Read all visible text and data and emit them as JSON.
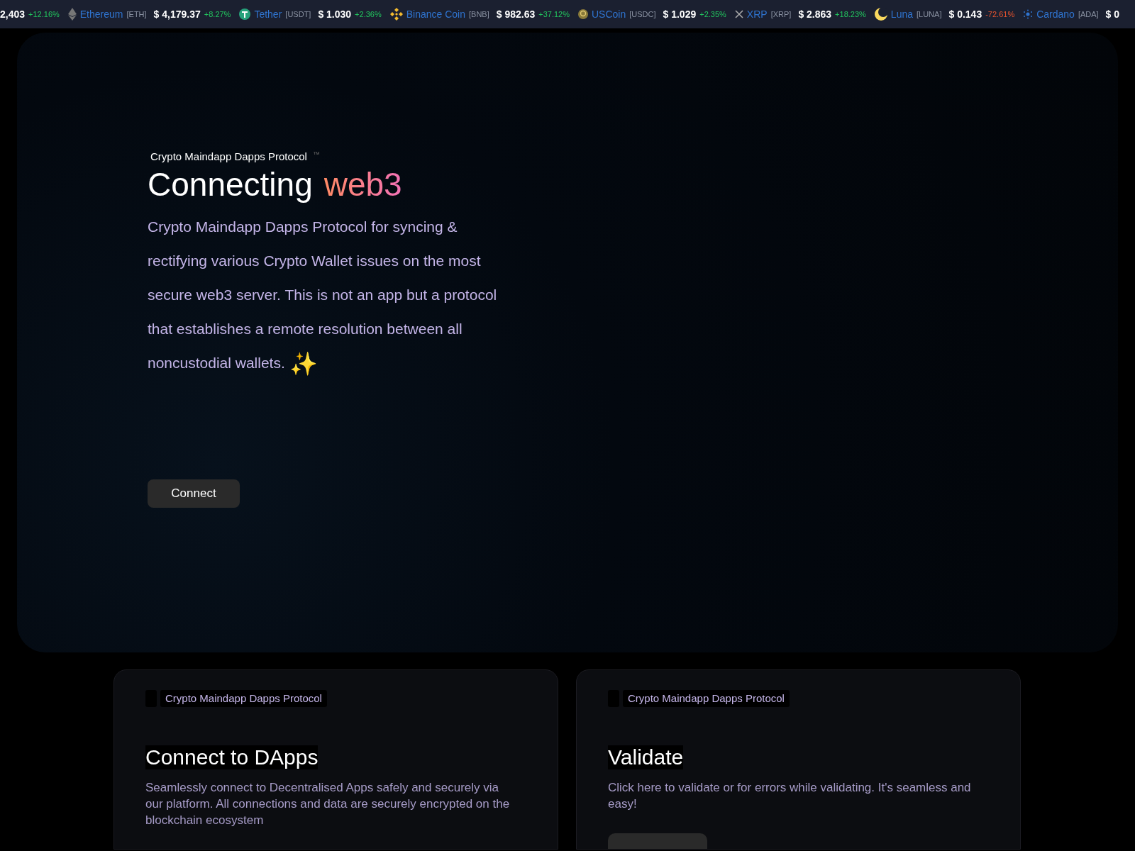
{
  "ticker": [
    {
      "price": "2,403",
      "change": "+12.16%",
      "color": "#22c55e"
    },
    {
      "name": "Ethereum",
      "symbol": "[ETH]",
      "price": "$ 4,179.37",
      "change": "+8.27%",
      "color": "#22c55e"
    },
    {
      "name": "Tether",
      "symbol": "[USDT]",
      "price": "$ 1.030",
      "change": "+2.36%",
      "color": "#22c55e"
    },
    {
      "name": "Binance Coin",
      "symbol": "[BNB]",
      "price": "$ 982.63",
      "change": "+37.12%",
      "color": "#22c55e"
    },
    {
      "name": "USCoin",
      "symbol": "[USDC]",
      "price": "$ 1.029",
      "change": "+2.35%",
      "color": "#22c55e"
    },
    {
      "name": "XRP",
      "symbol": "[XRP]",
      "price": "$ 2.863",
      "change": "+18.23%",
      "color": "#22c55e"
    },
    {
      "name": "Luna",
      "symbol": "[LUNA]",
      "price": "$ 0.143",
      "change": "-72.61%",
      "color": "#e8542f"
    },
    {
      "name": "Cardano",
      "symbol": "[ADA]",
      "price": "$ 0"
    }
  ],
  "hero": {
    "eyebrow": "Crypto Maindapp Dapps Protocol",
    "trademark": "™",
    "title": "Connecting",
    "highlight": "web3",
    "description": "Crypto Maindapp Dapps Protocol for syncing & rectifying various Crypto Wallet issues on the most secure web3 server. This is not an app but a protocol that establishes a remote resolution between all noncustodial wallets.",
    "emoji": "✨",
    "button": "Connect"
  },
  "cards": [
    {
      "badge": "Crypto Maindapp Dapps Protocol",
      "title": "Connect to DApps",
      "description": "Seamlessly connect to Decentralised Apps safely and securely via our platform. All connections and data are securely encrypted on the blockchain ecosystem"
    },
    {
      "badge": "Crypto Maindapp Dapps Protocol",
      "title": "Validate",
      "description": "Click here to validate or for errors while validating. It's seamless and easy!",
      "has_button": true
    }
  ]
}
